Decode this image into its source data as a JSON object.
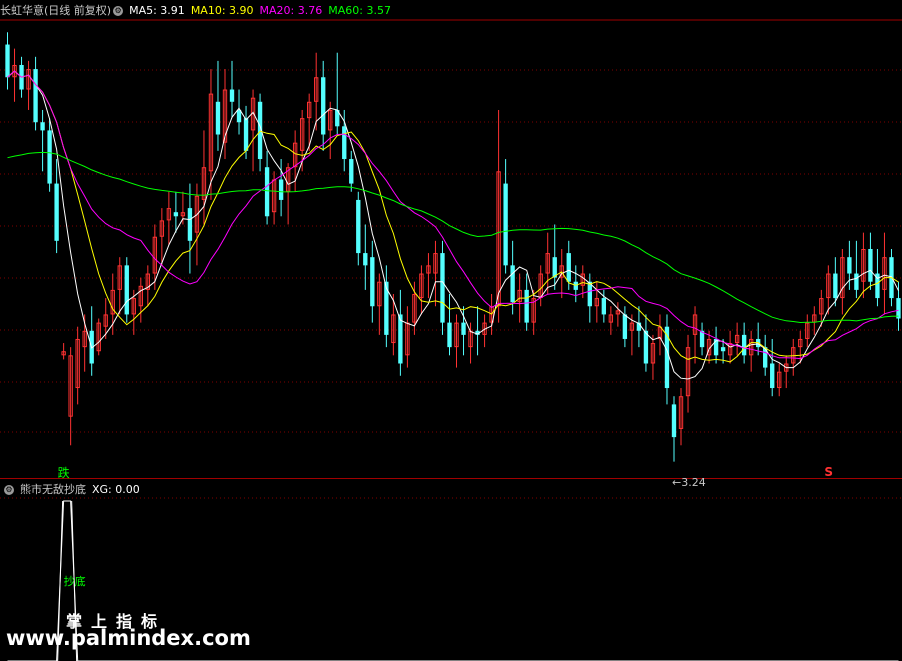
{
  "main_panel": {
    "stock_name": "长虹华意",
    "period": "(日线 前复权)",
    "gear_icon": "settings-gear-icon",
    "ma_readouts": [
      {
        "label": "MA5: 3.91",
        "color": "#ffffff"
      },
      {
        "label": "MA10: 3.90",
        "color": "#ffff00"
      },
      {
        "label": "MA20: 3.76",
        "color": "#ff00ff"
      },
      {
        "label": "MA60: 3.57",
        "color": "#00ff00"
      }
    ],
    "low_label": "3.24",
    "die_label": "跌",
    "s_label": "S"
  },
  "sub_panel": {
    "indicator_name": "熊市无敌抄底",
    "xg_readout": "XG: 0.00",
    "signal_label": "抄底"
  },
  "watermark": {
    "line1": "掌上指标",
    "line2": "www.palmindex.com"
  },
  "colors": {
    "up": "#ff3232",
    "down": "#54ffff",
    "ma5": "#ffffff",
    "ma10": "#ffff00",
    "ma20": "#ff00ff",
    "ma60": "#00ff00",
    "grid": "#7f0000",
    "axis": "#a00000"
  },
  "chart_data": {
    "type": "candlestick",
    "ylim": [
      3.2,
      4.32
    ],
    "grid": true,
    "candles": [
      [
        4.26,
        4.29,
        4.15,
        4.18
      ],
      [
        4.18,
        4.25,
        4.12,
        4.21
      ],
      [
        4.21,
        4.23,
        4.13,
        4.15
      ],
      [
        4.15,
        4.22,
        4.1,
        4.2
      ],
      [
        4.2,
        4.23,
        4.05,
        4.07
      ],
      [
        4.07,
        4.1,
        3.95,
        4.05
      ],
      [
        4.05,
        4.08,
        3.9,
        3.92
      ],
      [
        3.92,
        3.98,
        3.75,
        3.78
      ],
      [
        3.5,
        3.53,
        3.49,
        3.51
      ],
      [
        3.35,
        3.52,
        3.28,
        3.5
      ],
      [
        3.42,
        3.57,
        3.38,
        3.54
      ],
      [
        3.52,
        3.6,
        3.46,
        3.56
      ],
      [
        3.56,
        3.62,
        3.45,
        3.48
      ],
      [
        3.51,
        3.59,
        3.5,
        3.58
      ],
      [
        3.57,
        3.64,
        3.54,
        3.6
      ],
      [
        3.6,
        3.7,
        3.55,
        3.66
      ],
      [
        3.66,
        3.74,
        3.6,
        3.72
      ],
      [
        3.72,
        3.74,
        3.58,
        3.6
      ],
      [
        3.6,
        3.66,
        3.55,
        3.64
      ],
      [
        3.62,
        3.69,
        3.58,
        3.67
      ],
      [
        3.66,
        3.72,
        3.62,
        3.7
      ],
      [
        3.7,
        3.82,
        3.66,
        3.79
      ],
      [
        3.79,
        3.86,
        3.72,
        3.83
      ],
      [
        3.83,
        3.9,
        3.77,
        3.86
      ],
      [
        3.85,
        3.9,
        3.8,
        3.84
      ],
      [
        3.84,
        3.9,
        3.82,
        3.85
      ],
      [
        3.86,
        3.92,
        3.7,
        3.78
      ],
      [
        3.8,
        3.92,
        3.72,
        3.89
      ],
      [
        3.88,
        4.05,
        3.82,
        3.96
      ],
      [
        3.95,
        4.2,
        3.88,
        4.14
      ],
      [
        4.12,
        4.22,
        4.0,
        4.04
      ],
      [
        4.02,
        4.2,
        3.98,
        4.15
      ],
      [
        4.15,
        4.22,
        4.08,
        4.12
      ],
      [
        4.1,
        4.15,
        4.04,
        4.07
      ],
      [
        4.08,
        4.11,
        3.98,
        4.0
      ],
      [
        4.05,
        4.15,
        3.95,
        4.13
      ],
      [
        4.12,
        4.14,
        3.95,
        3.98
      ],
      [
        3.96,
        4.0,
        3.82,
        3.84
      ],
      [
        3.85,
        3.95,
        3.82,
        3.93
      ],
      [
        3.93,
        3.98,
        3.84,
        3.88
      ],
      [
        3.9,
        3.97,
        3.82,
        3.96
      ],
      [
        3.96,
        4.05,
        3.9,
        4.02
      ],
      [
        4.0,
        4.1,
        3.95,
        4.08
      ],
      [
        4.08,
        4.14,
        4.0,
        4.12
      ],
      [
        4.12,
        4.24,
        4.05,
        4.18
      ],
      [
        4.18,
        4.22,
        4.0,
        4.04
      ],
      [
        4.05,
        4.12,
        3.98,
        4.1
      ],
      [
        4.1,
        4.24,
        4.04,
        4.06
      ],
      [
        4.06,
        4.1,
        3.95,
        3.98
      ],
      [
        3.98,
        4.0,
        3.9,
        3.92
      ],
      [
        3.88,
        3.9,
        3.72,
        3.75
      ],
      [
        3.75,
        3.82,
        3.66,
        3.72
      ],
      [
        3.74,
        3.78,
        3.58,
        3.62
      ],
      [
        3.62,
        3.7,
        3.55,
        3.68
      ],
      [
        3.68,
        3.72,
        3.52,
        3.55
      ],
      [
        3.53,
        3.65,
        3.5,
        3.6
      ],
      [
        3.6,
        3.66,
        3.45,
        3.48
      ],
      [
        3.5,
        3.62,
        3.47,
        3.58
      ],
      [
        3.58,
        3.68,
        3.55,
        3.65
      ],
      [
        3.64,
        3.72,
        3.6,
        3.7
      ],
      [
        3.7,
        3.75,
        3.64,
        3.72
      ],
      [
        3.7,
        3.78,
        3.62,
        3.75
      ],
      [
        3.75,
        3.78,
        3.55,
        3.58
      ],
      [
        3.58,
        3.65,
        3.5,
        3.52
      ],
      [
        3.52,
        3.6,
        3.47,
        3.58
      ],
      [
        3.58,
        3.62,
        3.5,
        3.55
      ],
      [
        3.52,
        3.58,
        3.48,
        3.56
      ],
      [
        3.56,
        3.62,
        3.5,
        3.55
      ],
      [
        3.55,
        3.6,
        3.52,
        3.58
      ],
      [
        3.58,
        3.65,
        3.55,
        3.62
      ],
      [
        3.62,
        4.1,
        3.58,
        3.95
      ],
      [
        3.92,
        3.98,
        3.7,
        3.72
      ],
      [
        3.72,
        3.78,
        3.6,
        3.63
      ],
      [
        3.63,
        3.7,
        3.58,
        3.66
      ],
      [
        3.66,
        3.7,
        3.56,
        3.58
      ],
      [
        3.58,
        3.66,
        3.55,
        3.64
      ],
      [
        3.64,
        3.72,
        3.62,
        3.7
      ],
      [
        3.7,
        3.8,
        3.65,
        3.75
      ],
      [
        3.74,
        3.82,
        3.66,
        3.69
      ],
      [
        3.69,
        3.76,
        3.64,
        3.72
      ],
      [
        3.75,
        3.78,
        3.66,
        3.68
      ],
      [
        3.68,
        3.72,
        3.63,
        3.66
      ],
      [
        3.67,
        3.72,
        3.64,
        3.7
      ],
      [
        3.68,
        3.7,
        3.58,
        3.62
      ],
      [
        3.62,
        3.68,
        3.58,
        3.64
      ],
      [
        3.64,
        3.66,
        3.58,
        3.6
      ],
      [
        3.58,
        3.62,
        3.55,
        3.6
      ],
      [
        3.6,
        3.63,
        3.57,
        3.61
      ],
      [
        3.6,
        3.62,
        3.52,
        3.54
      ],
      [
        3.56,
        3.6,
        3.5,
        3.58
      ],
      [
        3.58,
        3.62,
        3.52,
        3.56
      ],
      [
        3.56,
        3.6,
        3.46,
        3.48
      ],
      [
        3.48,
        3.55,
        3.44,
        3.53
      ],
      [
        3.54,
        3.6,
        3.5,
        3.57
      ],
      [
        3.57,
        3.6,
        3.38,
        3.42
      ],
      [
        3.38,
        3.4,
        3.24,
        3.3
      ],
      [
        3.32,
        3.42,
        3.28,
        3.4
      ],
      [
        3.4,
        3.55,
        3.36,
        3.52
      ],
      [
        3.55,
        3.62,
        3.48,
        3.6
      ],
      [
        3.56,
        3.58,
        3.5,
        3.52
      ],
      [
        3.5,
        3.56,
        3.48,
        3.54
      ],
      [
        3.54,
        3.57,
        3.48,
        3.5
      ],
      [
        3.52,
        3.54,
        3.48,
        3.51
      ],
      [
        3.5,
        3.56,
        3.48,
        3.53
      ],
      [
        3.53,
        3.58,
        3.5,
        3.55
      ],
      [
        3.55,
        3.58,
        3.48,
        3.5
      ],
      [
        3.5,
        3.56,
        3.46,
        3.54
      ],
      [
        3.54,
        3.58,
        3.5,
        3.52
      ],
      [
        3.52,
        3.55,
        3.45,
        3.47
      ],
      [
        3.48,
        3.54,
        3.4,
        3.42
      ],
      [
        3.42,
        3.48,
        3.4,
        3.46
      ],
      [
        3.46,
        3.5,
        3.42,
        3.48
      ],
      [
        3.48,
        3.54,
        3.45,
        3.52
      ],
      [
        3.52,
        3.56,
        3.48,
        3.54
      ],
      [
        3.54,
        3.6,
        3.52,
        3.58
      ],
      [
        3.58,
        3.62,
        3.55,
        3.6
      ],
      [
        3.6,
        3.66,
        3.57,
        3.64
      ],
      [
        3.64,
        3.72,
        3.6,
        3.7
      ],
      [
        3.7,
        3.74,
        3.62,
        3.64
      ],
      [
        3.64,
        3.76,
        3.6,
        3.74
      ],
      [
        3.74,
        3.78,
        3.66,
        3.7
      ],
      [
        3.7,
        3.78,
        3.64,
        3.66
      ],
      [
        3.68,
        3.8,
        3.64,
        3.76
      ],
      [
        3.76,
        3.8,
        3.66,
        3.68
      ],
      [
        3.7,
        3.76,
        3.62,
        3.64
      ],
      [
        3.66,
        3.8,
        3.6,
        3.74
      ],
      [
        3.74,
        3.76,
        3.62,
        3.64
      ],
      [
        3.64,
        3.68,
        3.56,
        3.59
      ]
    ],
    "ma": [
      {
        "name": "MA5",
        "period": 5,
        "color": "#ffffff"
      },
      {
        "name": "MA10",
        "period": 10,
        "color": "#ffff00"
      },
      {
        "name": "MA20",
        "period": 20,
        "color": "#ff00ff"
      },
      {
        "name": "MA60",
        "period": 60,
        "color": "#00ff00"
      }
    ],
    "ma60_start": 3.98,
    "low_point": {
      "index": 95,
      "value": 3.24
    },
    "die_point": {
      "index": 8
    },
    "s_point": {
      "index": 117
    },
    "sub": {
      "ylim": [
        0,
        1
      ],
      "values": [
        0,
        0,
        0,
        0,
        0,
        0,
        0,
        0,
        1,
        1,
        0,
        0,
        0,
        0,
        0,
        0,
        0,
        0,
        0,
        0,
        0,
        0,
        0,
        0,
        0,
        0,
        0,
        0,
        0,
        0,
        0,
        0,
        0,
        0,
        0,
        0,
        0,
        0,
        0,
        0,
        0,
        0,
        0,
        0,
        0,
        0,
        0,
        0,
        0,
        0,
        0,
        0,
        0,
        0,
        0,
        0,
        0,
        0,
        0,
        0,
        0,
        0,
        0,
        0,
        0,
        0,
        0,
        0,
        0,
        0,
        0,
        0,
        0,
        0,
        0,
        0,
        0,
        0,
        0,
        0,
        0,
        0,
        0,
        0,
        0,
        0,
        0,
        0,
        0,
        0,
        0,
        0,
        0,
        0,
        0,
        0,
        0,
        0,
        0,
        0,
        0,
        0,
        0,
        0,
        0,
        0,
        0,
        0,
        0,
        0,
        0,
        0,
        0,
        0,
        0,
        0,
        0,
        0,
        0,
        0,
        0,
        0,
        0,
        0,
        0,
        0,
        0,
        0
      ]
    }
  }
}
